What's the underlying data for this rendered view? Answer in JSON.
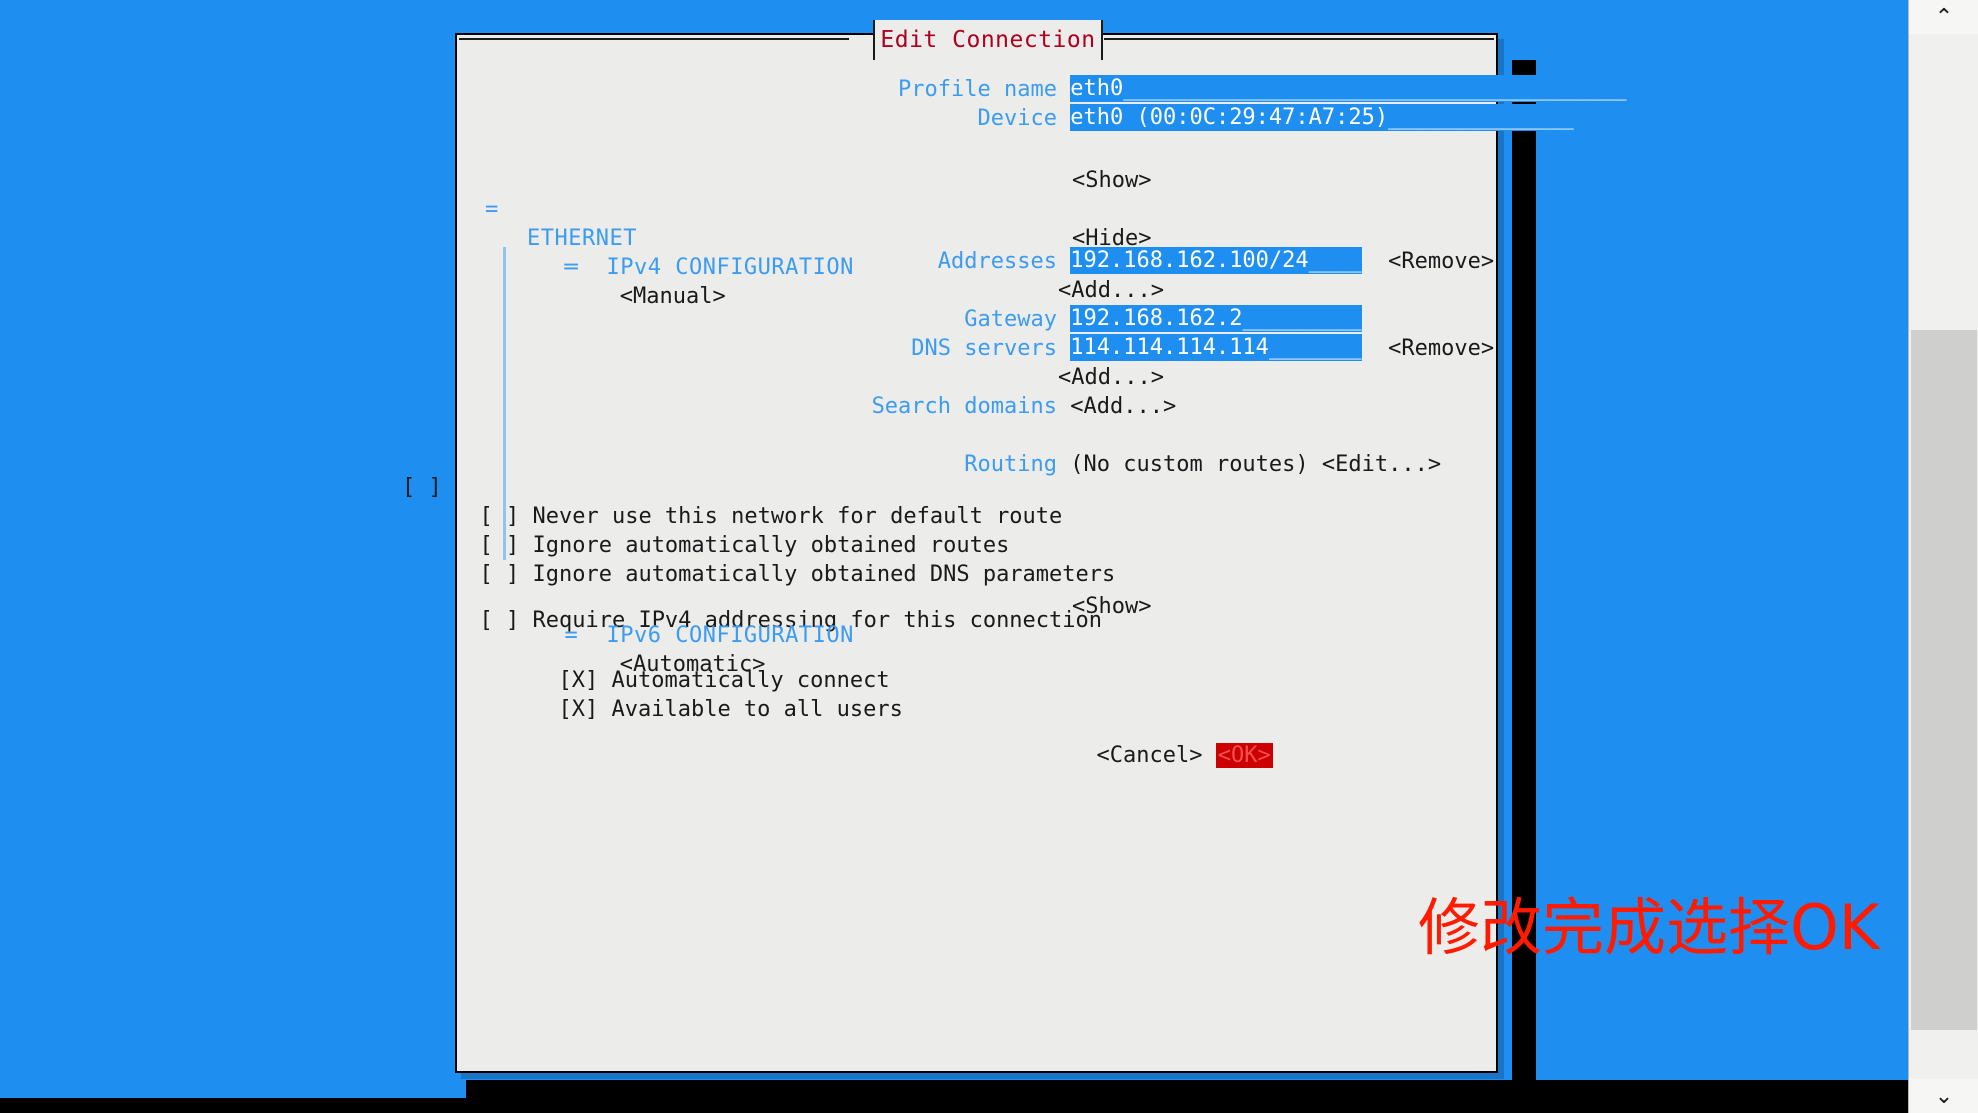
{
  "window": {
    "title": "Edit Connection",
    "background_color": "#1f8ef1",
    "dialog_background": "#ececeb",
    "title_color": "#b00020"
  },
  "scrollbar": {
    "up_arrow": "⌃",
    "down_arrow": "⌄"
  },
  "form": {
    "profile_name": {
      "label": "Profile name",
      "value": "eth0",
      "tail": "______________________________________"
    },
    "device": {
      "label": "Device",
      "value": "eth0 (00:0C:29:47:A7:25)",
      "tail": "______________"
    }
  },
  "ethernet_section": {
    "marker": "=",
    "title": "ETHERNET",
    "toggle": "<Show>"
  },
  "ipv4_section": {
    "marker": "═",
    "title": "IPv4 CONFIGURATION",
    "method": "<Manual>",
    "toggle": "<Hide>",
    "addresses": {
      "label": "Addresses",
      "value": "192.168.162.100/24",
      "tail": "____",
      "remove": "<Remove>",
      "add": "<Add...>"
    },
    "gateway": {
      "label": "Gateway",
      "value": "192.168.162.2",
      "tail": "_________"
    },
    "dns_servers": {
      "label": "DNS servers",
      "value": "114.114.114.114",
      "tail": "_______",
      "remove": "<Remove>",
      "add": "<Add...>"
    },
    "search_domains": {
      "label": "Search domains",
      "add": "<Add...>"
    },
    "routing": {
      "label": "Routing",
      "value": "(No custom routes)",
      "edit": "<Edit...>"
    },
    "checkboxes": [
      {
        "box": "[ ]",
        "label": "Never use this network for default route",
        "checked": false
      },
      {
        "box": "[ ]",
        "label": "Ignore automatically obtained routes",
        "checked": false
      },
      {
        "box": "[ ]",
        "label": "Ignore automatically obtained DNS parameters",
        "checked": false
      }
    ],
    "require_ipv4": {
      "box": "[ ]",
      "label": "Require IPv4 addressing for this connection",
      "checked": false
    }
  },
  "ipv6_section": {
    "marker": "=",
    "title": "IPv6 CONFIGURATION",
    "method": "<Automatic>",
    "toggle": "<Show>"
  },
  "global_options": [
    {
      "box": "[X]",
      "label": "Automatically connect",
      "checked": true
    },
    {
      "box": "[X]",
      "label": "Available to all users",
      "checked": true
    }
  ],
  "buttons": {
    "cancel": "<Cancel>",
    "ok": "<OK>",
    "ok_background": "#cc0000"
  },
  "annotation": {
    "text": "修改完成选择OK",
    "color": "#ff1a00"
  }
}
